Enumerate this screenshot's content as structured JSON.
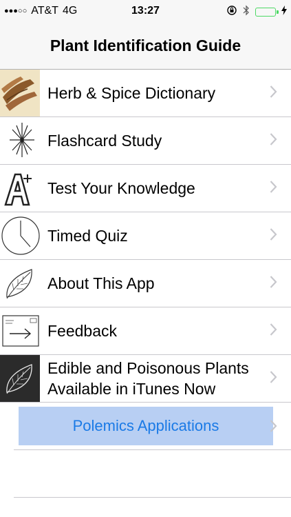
{
  "status": {
    "carrier": "AT&T",
    "network": "4G",
    "time": "13:27",
    "signal_glyph": "●●●○○"
  },
  "nav": {
    "title": "Plant Identification Guide"
  },
  "menu": {
    "items": [
      {
        "label": "Herb & Spice Dictionary",
        "icon": "spices-photo-icon"
      },
      {
        "label": "Flashcard Study",
        "icon": "sparkle-star-icon"
      },
      {
        "label": "Test Your Knowledge",
        "icon": "a-plus-grade-icon"
      },
      {
        "label": "Timed Quiz",
        "icon": "clock-icon"
      },
      {
        "label": "About This App",
        "icon": "leaf-sketch-icon"
      },
      {
        "label": "Feedback",
        "icon": "envelope-arrow-icon"
      },
      {
        "label": "Edible and Poisonous Plants Available in iTunes Now",
        "icon": "leaf-dark-icon"
      }
    ],
    "promo_label": "Polemics Applications"
  },
  "colors": {
    "battery": "#4cd964",
    "promo_bg": "#b8cff3",
    "promo_text": "#1a7ae6",
    "separator": "#c8c7cc"
  }
}
